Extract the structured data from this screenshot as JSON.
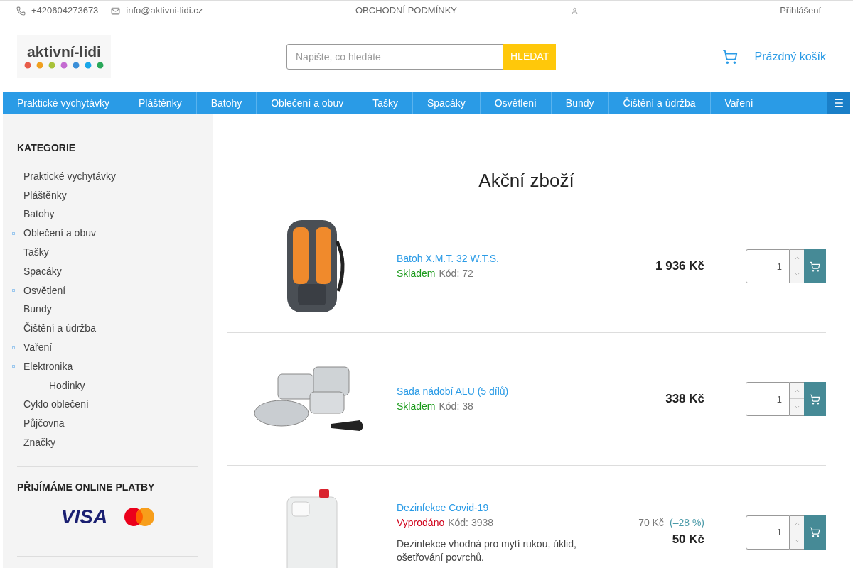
{
  "topbar": {
    "phone": "+420604273673",
    "email": "info@aktivni-lidi.cz",
    "terms_link": "OBCHODNÍ PODMÍNKY",
    "login_link": "Přihlášení"
  },
  "header": {
    "logo_text": "aktivní-lidi",
    "search": {
      "placeholder": "Napište, co hledáte",
      "button": "HLEDAT"
    },
    "cart": "Prázdný košík"
  },
  "nav": [
    "Praktické vychytávky",
    "Pláštěnky",
    "Batohy",
    "Oblečení a obuv",
    "Tašky",
    "Spacáky",
    "Osvětlení",
    "Bundy",
    "Čištění a údržba",
    "Vaření"
  ],
  "sidebar": {
    "categories_title": "KATEGORIE",
    "categories": [
      {
        "label": "Praktické vychytávky",
        "expandable": false
      },
      {
        "label": "Pláštěnky",
        "expandable": false
      },
      {
        "label": "Batohy",
        "expandable": false
      },
      {
        "label": "Oblečení a obuv",
        "expandable": true
      },
      {
        "label": "Tašky",
        "expandable": false
      },
      {
        "label": "Spacáky",
        "expandable": false
      },
      {
        "label": "Osvětlení",
        "expandable": true
      },
      {
        "label": "Bundy",
        "expandable": false
      },
      {
        "label": "Čištění a údržba",
        "expandable": false
      },
      {
        "label": "Vaření",
        "expandable": true
      },
      {
        "label": "Elektronika",
        "expandable": true,
        "children": [
          {
            "label": "Hodinky",
            "expandable": false
          }
        ]
      },
      {
        "label": "Cyklo oblečení",
        "expandable": false
      },
      {
        "label": "Půjčovna",
        "expandable": false
      },
      {
        "label": "Značky",
        "expandable": false
      }
    ],
    "payments_title": "PŘIJÍMÁME ONLINE PLATBY",
    "visa": "VISA"
  },
  "main": {
    "title": "Akční zboží",
    "products": [
      {
        "kind": "backpack",
        "name": "Batoh X.M.T. 32 W.T.S.",
        "availability": "Skladem",
        "in_stock": true,
        "code": "Kód: 72",
        "price": "1 936 Kč",
        "quantity": "1"
      },
      {
        "kind": "cookware",
        "name": "Sada nádobí ALU (5 dílů)",
        "availability": "Skladem",
        "in_stock": true,
        "code": "Kód: 38",
        "price": "338 Kč",
        "quantity": "1"
      },
      {
        "kind": "canister",
        "name": "Dezinfekce Covid-19",
        "availability": "Vyprodáno",
        "in_stock": false,
        "code": "Kód: 3938",
        "description": "Dezinfekce vhodná pro mytí rukou, úklid, ošetřování povrchů.",
        "old_price": "70 Kč",
        "discount": "(–28 %)",
        "price": "50 Kč",
        "quantity": "1"
      }
    ]
  }
}
